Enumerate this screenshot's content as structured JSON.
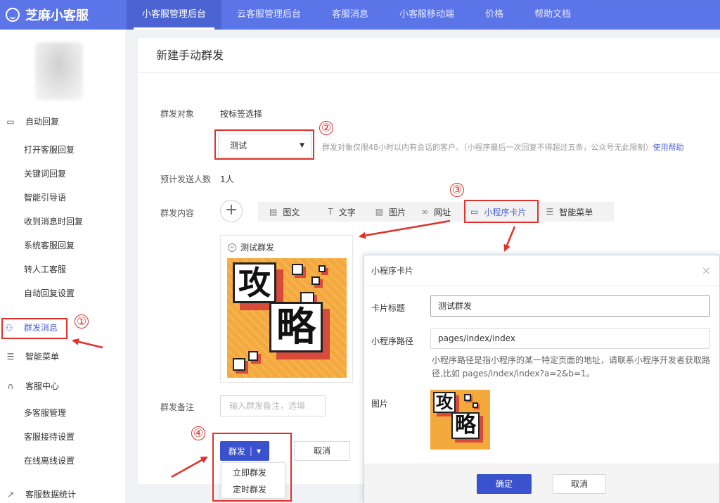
{
  "brand": {
    "name": "芝麻小客服"
  },
  "nav": [
    {
      "label": "小客服管理后台",
      "active": true
    },
    {
      "label": "云客服管理后台"
    },
    {
      "label": "客服消息"
    },
    {
      "label": "小客服移动端"
    },
    {
      "label": "价格"
    },
    {
      "label": "帮助文档"
    }
  ],
  "sidebar": {
    "auto_reply": "自动回复",
    "auto_reply_items": [
      "打开客服回复",
      "关键词回复",
      "智能引导语",
      "收到消息时回复",
      "系统客服回复",
      "转人工客服",
      "自动回复设置"
    ],
    "broadcast": "群发消息",
    "smart_menu": "智能菜单",
    "service_center": "客服中心",
    "service_items": [
      "多客服管理",
      "客服接待设置",
      "在线离线设置"
    ],
    "stats": "客服数据统计"
  },
  "page": {
    "title": "新建手动群发",
    "target_label": "群发对象",
    "target_value": "按标签选择",
    "tag_select": "测试",
    "hint_text": "群发对象仅限48小时以内有会话的客户。（小程序最后一次回复不得超过五条，公众号无此限制）",
    "hint_link": "使用帮助",
    "estimate_label": "预计发送人数",
    "estimate_value": "1人",
    "content_label": "群发内容",
    "tabs": [
      "图文",
      "文字",
      "图片",
      "网址",
      "小程序卡片",
      "智能菜单"
    ],
    "preview_title": "测试群发",
    "remark_label": "群发备注",
    "remark_placeholder": "输入群发备注，选填",
    "send_button": "群发",
    "cancel_button": "取消",
    "dropdown": [
      "立即群发",
      "定时群发"
    ]
  },
  "poster": {
    "char1": "攻",
    "char2": "略"
  },
  "dialog": {
    "title": "小程序卡片",
    "close": "×",
    "card_title_label": "卡片标题",
    "card_title_value": "测试群发",
    "path_label": "小程序路径",
    "path_value": "pages/index/index",
    "path_desc": "小程序路径是指小程序的某一特定页面的地址，请联系小程序开发者获取路径,比如 pages/index/index?a=2&b=1。",
    "image_label": "图片",
    "ok": "确定",
    "cancel": "取消"
  },
  "annotations": [
    "①",
    "②",
    "③",
    "④"
  ],
  "colors": {
    "primary": "#3b52cf",
    "topbar": "#5b74e8",
    "annotation": "#e0312b",
    "poster": "#f4a93c"
  }
}
